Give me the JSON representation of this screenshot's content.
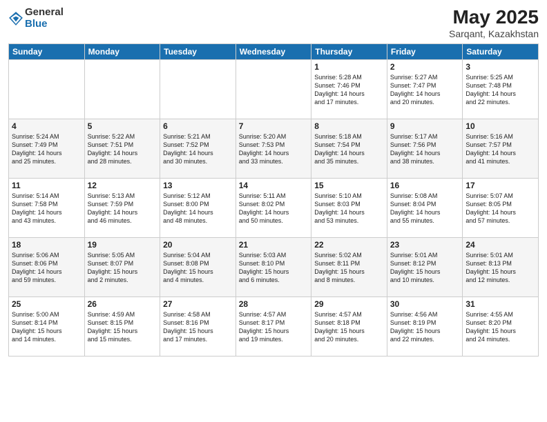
{
  "header": {
    "logo_general": "General",
    "logo_blue": "Blue",
    "month": "May 2025",
    "location": "Sarqant, Kazakhstan"
  },
  "weekdays": [
    "Sunday",
    "Monday",
    "Tuesday",
    "Wednesday",
    "Thursday",
    "Friday",
    "Saturday"
  ],
  "weeks": [
    [
      {
        "day": "",
        "info": ""
      },
      {
        "day": "",
        "info": ""
      },
      {
        "day": "",
        "info": ""
      },
      {
        "day": "",
        "info": ""
      },
      {
        "day": "1",
        "info": "Sunrise: 5:28 AM\nSunset: 7:46 PM\nDaylight: 14 hours\nand 17 minutes."
      },
      {
        "day": "2",
        "info": "Sunrise: 5:27 AM\nSunset: 7:47 PM\nDaylight: 14 hours\nand 20 minutes."
      },
      {
        "day": "3",
        "info": "Sunrise: 5:25 AM\nSunset: 7:48 PM\nDaylight: 14 hours\nand 22 minutes."
      }
    ],
    [
      {
        "day": "4",
        "info": "Sunrise: 5:24 AM\nSunset: 7:49 PM\nDaylight: 14 hours\nand 25 minutes."
      },
      {
        "day": "5",
        "info": "Sunrise: 5:22 AM\nSunset: 7:51 PM\nDaylight: 14 hours\nand 28 minutes."
      },
      {
        "day": "6",
        "info": "Sunrise: 5:21 AM\nSunset: 7:52 PM\nDaylight: 14 hours\nand 30 minutes."
      },
      {
        "day": "7",
        "info": "Sunrise: 5:20 AM\nSunset: 7:53 PM\nDaylight: 14 hours\nand 33 minutes."
      },
      {
        "day": "8",
        "info": "Sunrise: 5:18 AM\nSunset: 7:54 PM\nDaylight: 14 hours\nand 35 minutes."
      },
      {
        "day": "9",
        "info": "Sunrise: 5:17 AM\nSunset: 7:56 PM\nDaylight: 14 hours\nand 38 minutes."
      },
      {
        "day": "10",
        "info": "Sunrise: 5:16 AM\nSunset: 7:57 PM\nDaylight: 14 hours\nand 41 minutes."
      }
    ],
    [
      {
        "day": "11",
        "info": "Sunrise: 5:14 AM\nSunset: 7:58 PM\nDaylight: 14 hours\nand 43 minutes."
      },
      {
        "day": "12",
        "info": "Sunrise: 5:13 AM\nSunset: 7:59 PM\nDaylight: 14 hours\nand 46 minutes."
      },
      {
        "day": "13",
        "info": "Sunrise: 5:12 AM\nSunset: 8:00 PM\nDaylight: 14 hours\nand 48 minutes."
      },
      {
        "day": "14",
        "info": "Sunrise: 5:11 AM\nSunset: 8:02 PM\nDaylight: 14 hours\nand 50 minutes."
      },
      {
        "day": "15",
        "info": "Sunrise: 5:10 AM\nSunset: 8:03 PM\nDaylight: 14 hours\nand 53 minutes."
      },
      {
        "day": "16",
        "info": "Sunrise: 5:08 AM\nSunset: 8:04 PM\nDaylight: 14 hours\nand 55 minutes."
      },
      {
        "day": "17",
        "info": "Sunrise: 5:07 AM\nSunset: 8:05 PM\nDaylight: 14 hours\nand 57 minutes."
      }
    ],
    [
      {
        "day": "18",
        "info": "Sunrise: 5:06 AM\nSunset: 8:06 PM\nDaylight: 14 hours\nand 59 minutes."
      },
      {
        "day": "19",
        "info": "Sunrise: 5:05 AM\nSunset: 8:07 PM\nDaylight: 15 hours\nand 2 minutes."
      },
      {
        "day": "20",
        "info": "Sunrise: 5:04 AM\nSunset: 8:08 PM\nDaylight: 15 hours\nand 4 minutes."
      },
      {
        "day": "21",
        "info": "Sunrise: 5:03 AM\nSunset: 8:10 PM\nDaylight: 15 hours\nand 6 minutes."
      },
      {
        "day": "22",
        "info": "Sunrise: 5:02 AM\nSunset: 8:11 PM\nDaylight: 15 hours\nand 8 minutes."
      },
      {
        "day": "23",
        "info": "Sunrise: 5:01 AM\nSunset: 8:12 PM\nDaylight: 15 hours\nand 10 minutes."
      },
      {
        "day": "24",
        "info": "Sunrise: 5:01 AM\nSunset: 8:13 PM\nDaylight: 15 hours\nand 12 minutes."
      }
    ],
    [
      {
        "day": "25",
        "info": "Sunrise: 5:00 AM\nSunset: 8:14 PM\nDaylight: 15 hours\nand 14 minutes."
      },
      {
        "day": "26",
        "info": "Sunrise: 4:59 AM\nSunset: 8:15 PM\nDaylight: 15 hours\nand 15 minutes."
      },
      {
        "day": "27",
        "info": "Sunrise: 4:58 AM\nSunset: 8:16 PM\nDaylight: 15 hours\nand 17 minutes."
      },
      {
        "day": "28",
        "info": "Sunrise: 4:57 AM\nSunset: 8:17 PM\nDaylight: 15 hours\nand 19 minutes."
      },
      {
        "day": "29",
        "info": "Sunrise: 4:57 AM\nSunset: 8:18 PM\nDaylight: 15 hours\nand 20 minutes."
      },
      {
        "day": "30",
        "info": "Sunrise: 4:56 AM\nSunset: 8:19 PM\nDaylight: 15 hours\nand 22 minutes."
      },
      {
        "day": "31",
        "info": "Sunrise: 4:55 AM\nSunset: 8:20 PM\nDaylight: 15 hours\nand 24 minutes."
      }
    ]
  ]
}
